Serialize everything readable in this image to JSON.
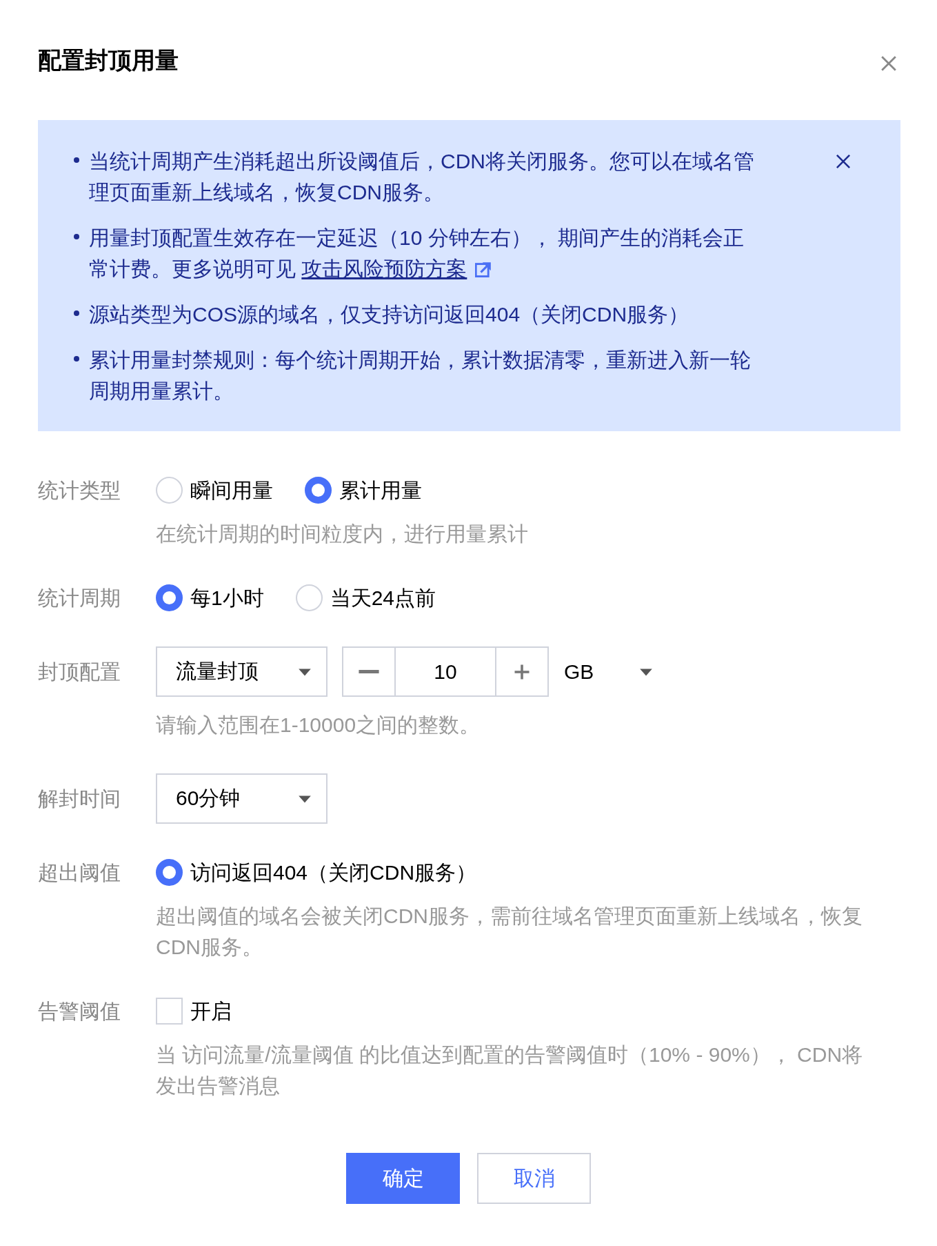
{
  "dialog": {
    "title": "配置封顶用量"
  },
  "notice": {
    "items": [
      {
        "text": "当统计周期产生消耗超出所设阈值后，CDN将关闭服务。您可以在域名管理页面重新上线域名，恢复CDN服务。"
      },
      {
        "text": "用量封顶配置生效存在一定延迟（10 分钟左右）， 期间产生的消耗会正常计费。更多说明可见 ",
        "link": "攻击风险预防方案"
      },
      {
        "text": "源站类型为COS源的域名，仅支持访问返回404（关闭CDN服务）"
      },
      {
        "text": "累计用量封禁规则：每个统计周期开始，累计数据清零，重新进入新一轮周期用量累计。"
      }
    ]
  },
  "form": {
    "rows": [
      {
        "kind": "radio",
        "label": "统计类型",
        "options": [
          {
            "label": "瞬间用量",
            "selected": false
          },
          {
            "label": "累计用量",
            "selected": true
          }
        ],
        "hint": "在统计周期的时间粒度内，进行用量累计"
      },
      {
        "kind": "radio",
        "label": "统计周期",
        "options": [
          {
            "label": "每1小时",
            "selected": true
          },
          {
            "label": "当天24点前",
            "selected": false
          }
        ]
      },
      {
        "kind": "quota",
        "label": "封顶配置",
        "select": {
          "value": "流量封顶"
        },
        "stepper": {
          "value": "10"
        },
        "unit": {
          "value": "GB"
        },
        "hint": "请输入范围在1-10000之间的整数。"
      },
      {
        "kind": "select",
        "label": "解封时间",
        "select": {
          "value": "60分钟"
        }
      },
      {
        "kind": "radio",
        "label": "超出阈值",
        "options": [
          {
            "label": "访问返回404（关闭CDN服务）",
            "selected": true
          }
        ],
        "hint": "超出阈值的域名会被关闭CDN服务，需前往域名管理页面重新上线域名，恢复CDN服务。"
      },
      {
        "kind": "checkbox",
        "label": "告警阈值",
        "checkbox": {
          "label": "开启",
          "checked": false
        },
        "hint": "当 访问流量/流量阈值 的比值达到配置的告警阈值时（10% - 90%）， CDN将发出告警消息"
      }
    ]
  },
  "buttons": [
    {
      "label": "确定",
      "kind": "primary"
    },
    {
      "label": "取消",
      "kind": "secondary"
    }
  ]
}
